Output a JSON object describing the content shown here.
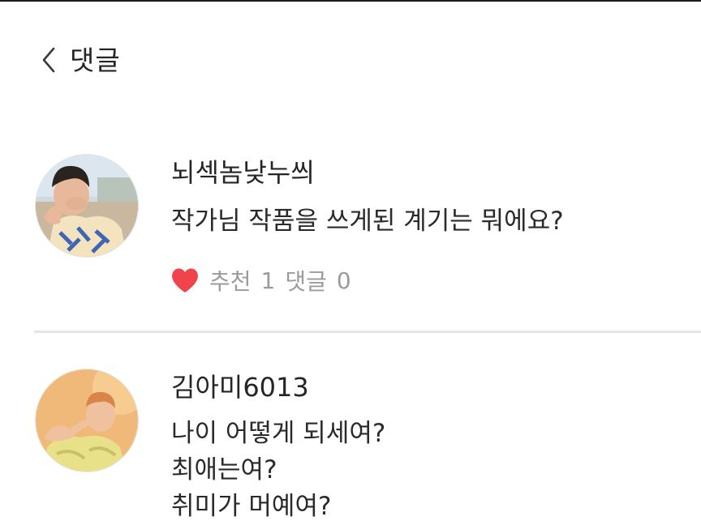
{
  "header": {
    "title": "댓글",
    "back_icon": "chevron-left-icon"
  },
  "comments": [
    {
      "username": "뇌섹놈낮누씌",
      "text_lines": [
        "작가님  작품을 쓰게된 계기는 뭐에요?"
      ],
      "like_icon": "heart-icon",
      "like_color": "#f0444d",
      "recommend_label": "추천",
      "recommend_count": "1",
      "reply_label": "댓글",
      "reply_count": "0"
    },
    {
      "username": "김아미6013",
      "text_lines": [
        "나이 어떻게 되세여?",
        "최애는여?",
        "취미가 머예여?"
      ]
    }
  ],
  "colors": {
    "divider": "#e4e4e4",
    "meta_text": "#9b9b9b",
    "heart": "#f0444d"
  }
}
